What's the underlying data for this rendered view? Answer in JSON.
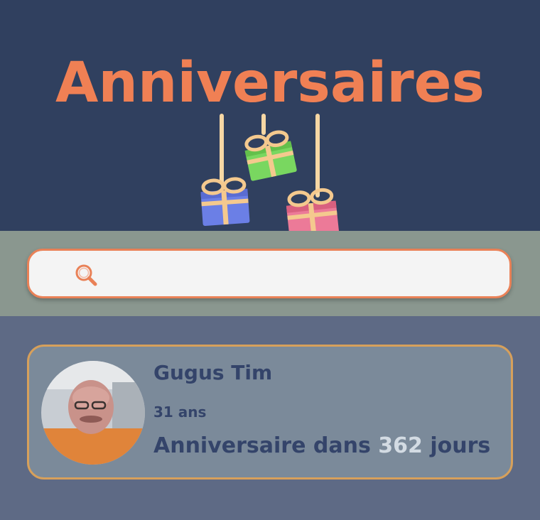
{
  "header": {
    "title": "Anniversaires"
  },
  "search": {
    "placeholder": "",
    "value": ""
  },
  "birthdays": [
    {
      "name": "Gugus Tim",
      "age_text": "31 ans",
      "countdown_prefix": "Anniversaire dans",
      "days": "362",
      "countdown_suffix": "jours"
    }
  ],
  "colors": {
    "header_bg": "#30405f",
    "title": "#f08054",
    "search_band": "#8a978f",
    "search_border": "#e98157",
    "page_bg": "#5e6a85",
    "card_bg": "#7b8a9a",
    "card_border": "#d7a05b",
    "card_text": "#34446a",
    "days_highlight": "#d3dbe3"
  },
  "icons": {
    "search": "magnifier-icon",
    "gifts": [
      "gift-blue-icon",
      "gift-green-icon",
      "gift-pink-icon"
    ]
  }
}
